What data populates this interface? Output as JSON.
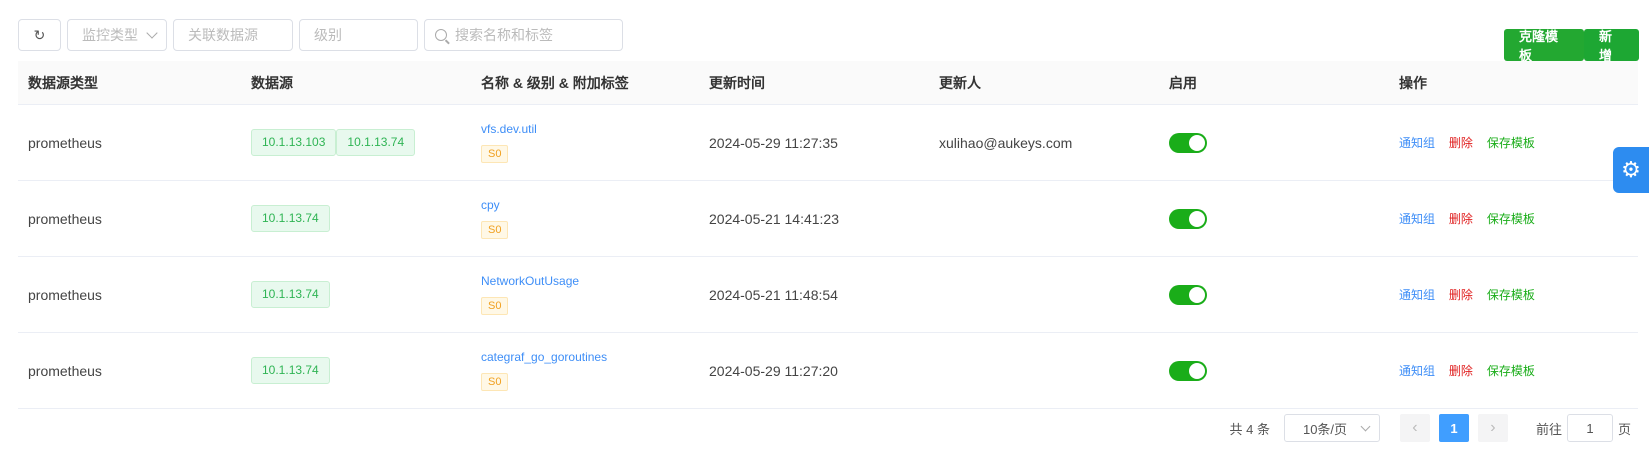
{
  "toolbar": {
    "refresh_icon": "refresh-icon",
    "type_placeholder": "监控类型",
    "datasource_placeholder": "关联数据源",
    "level_placeholder": "级别",
    "search_placeholder": "搜索名称和标签"
  },
  "actions": {
    "clone": "克隆模板",
    "add": "新增"
  },
  "table": {
    "headers": [
      "数据源类型",
      "数据源",
      "名称 & 级别 & 附加标签",
      "更新时间",
      "更新人",
      "启用",
      "操作"
    ],
    "rows": [
      {
        "type": "prometheus",
        "datasources": [
          "10.1.13.103",
          "10.1.13.74"
        ],
        "name": "vfs.dev.util",
        "level": "S0",
        "updated_at": "2024-05-29 11:27:35",
        "updated_by": "xulihao@aukeys.com",
        "enabled": true,
        "ops": [
          "通知组",
          "删除",
          "保存模板"
        ]
      },
      {
        "type": "prometheus",
        "datasources": [
          "10.1.13.74"
        ],
        "name": "cpy",
        "level": "S0",
        "updated_at": "2024-05-21 14:41:23",
        "updated_by": "",
        "enabled": true,
        "ops": [
          "通知组",
          "删除",
          "保存模板"
        ]
      },
      {
        "type": "prometheus",
        "datasources": [
          "10.1.13.74"
        ],
        "name": "NetworkOutUsage",
        "level": "S0",
        "updated_at": "2024-05-21 11:48:54",
        "updated_by": "",
        "enabled": true,
        "ops": [
          "通知组",
          "删除",
          "保存模板"
        ]
      },
      {
        "type": "prometheus",
        "datasources": [
          "10.1.13.74"
        ],
        "name": "categraf_go_goroutines",
        "level": "S0",
        "updated_at": "2024-05-29 11:27:20",
        "updated_by": "",
        "enabled": true,
        "ops": [
          "通知组",
          "删除",
          "保存模板"
        ]
      }
    ]
  },
  "pagination": {
    "total": "共 4 条",
    "page_size": "10条/页",
    "current_page": "1",
    "goto_prefix": "前往",
    "goto_value": "1",
    "goto_suffix": "页"
  },
  "colors": {
    "primary_green": "#1aad19",
    "link_blue": "#3e8ef7",
    "danger_red": "#e02020",
    "page_blue": "#409eff"
  }
}
